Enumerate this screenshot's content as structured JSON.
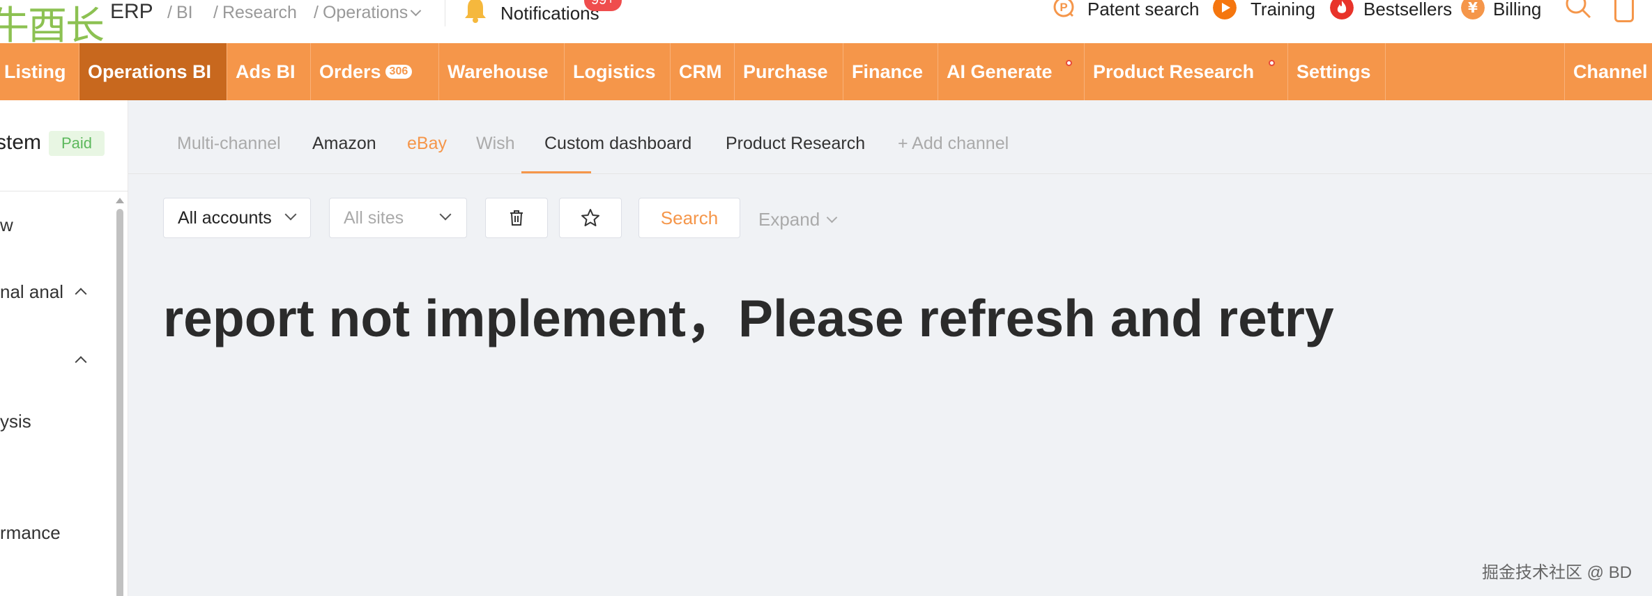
{
  "topbar": {
    "logo_text": "牛酉长",
    "app_name": "ERP",
    "breadcrumb": [
      "BI",
      "Research",
      "Operations"
    ],
    "notifications_label": "Notifications",
    "notifications_badge": "99+",
    "items": [
      "Patent search",
      "Training",
      "Bestsellers",
      "Billing"
    ]
  },
  "mainnav": {
    "items": [
      "Listing",
      "Operations BI",
      "Ads BI",
      "Orders",
      "Warehouse",
      "Logistics",
      "CRM",
      "Purchase",
      "Finance",
      "AI Generate",
      "Product Research",
      "Settings",
      "Channel"
    ],
    "orders_badge": "306",
    "active": "Operations BI"
  },
  "sidebar": {
    "title": "stem",
    "paid_badge": "Paid",
    "items": [
      "w",
      "nal anal",
      "",
      "ysis",
      "rmance"
    ]
  },
  "tabs": {
    "items": [
      "Multi-channel",
      "Amazon",
      "eBay",
      "Wish",
      "Custom dashboard",
      "Product Research",
      "+ Add channel"
    ],
    "active": "eBay"
  },
  "filters": {
    "accounts": "All accounts",
    "sites_placeholder": "All sites",
    "search_label": "Search",
    "expand_label": "Expand"
  },
  "message": "report not implement，Please refresh and retry",
  "watermark": "掘金技术社区 @ BD",
  "colors": {
    "accent": "#f5964a",
    "active_nav": "#c8681e",
    "badge_red": "#ef4d4d",
    "paid_green": "#5cb85c"
  }
}
